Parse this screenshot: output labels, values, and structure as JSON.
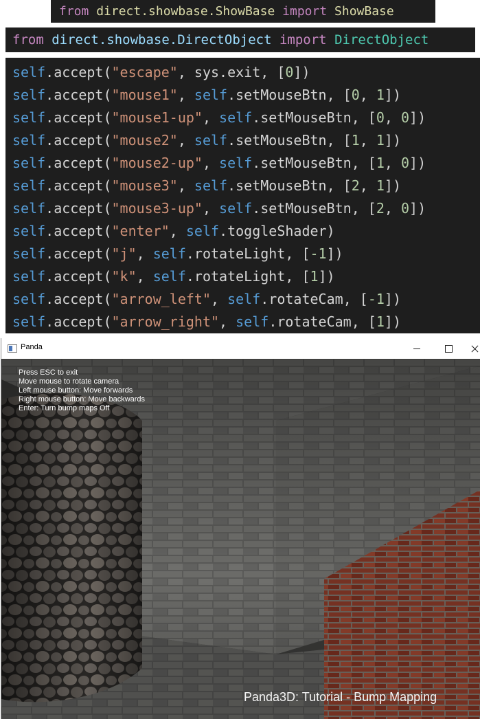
{
  "snippet1": {
    "keyword_from": "from",
    "module": "direct.showbase.ShowBase",
    "keyword_import": "import",
    "class": "ShowBase"
  },
  "snippet2": {
    "keyword_from": "from",
    "module": "direct.showbase.DirectObject",
    "keyword_import": "import",
    "class": "DirectObject"
  },
  "code_lines": [
    {
      "self": "self",
      "call": ".accept(",
      "event": "\"escape\"",
      "sep": ", ",
      "handler_self": "",
      "handler": "sys.exit",
      "args_pre": ", [",
      "a1": "0",
      "mid": "",
      "a2": "",
      "args_post": "])"
    },
    {
      "self": "self",
      "call": ".accept(",
      "event": "\"mouse1\"",
      "sep": ", ",
      "handler_self": "self",
      "handler": ".setMouseBtn",
      "args_pre": ", [",
      "a1": "0",
      "mid": ", ",
      "a2": "1",
      "args_post": "])"
    },
    {
      "self": "self",
      "call": ".accept(",
      "event": "\"mouse1-up\"",
      "sep": ", ",
      "handler_self": "self",
      "handler": ".setMouseBtn",
      "args_pre": ", [",
      "a1": "0",
      "mid": ", ",
      "a2": "0",
      "args_post": "])"
    },
    {
      "self": "self",
      "call": ".accept(",
      "event": "\"mouse2\"",
      "sep": ", ",
      "handler_self": "self",
      "handler": ".setMouseBtn",
      "args_pre": ", [",
      "a1": "1",
      "mid": ", ",
      "a2": "1",
      "args_post": "])"
    },
    {
      "self": "self",
      "call": ".accept(",
      "event": "\"mouse2-up\"",
      "sep": ", ",
      "handler_self": "self",
      "handler": ".setMouseBtn",
      "args_pre": ", [",
      "a1": "1",
      "mid": ", ",
      "a2": "0",
      "args_post": "])"
    },
    {
      "self": "self",
      "call": ".accept(",
      "event": "\"mouse3\"",
      "sep": ", ",
      "handler_self": "self",
      "handler": ".setMouseBtn",
      "args_pre": ", [",
      "a1": "2",
      "mid": ", ",
      "a2": "1",
      "args_post": "])"
    },
    {
      "self": "self",
      "call": ".accept(",
      "event": "\"mouse3-up\"",
      "sep": ", ",
      "handler_self": "self",
      "handler": ".setMouseBtn",
      "args_pre": ", [",
      "a1": "2",
      "mid": ", ",
      "a2": "0",
      "args_post": "])"
    },
    {
      "self": "self",
      "call": ".accept(",
      "event": "\"enter\"",
      "sep": ", ",
      "handler_self": "self",
      "handler": ".toggleShader",
      "args_pre": "",
      "a1": "",
      "mid": "",
      "a2": "",
      "args_post": ")"
    },
    {
      "self": "self",
      "call": ".accept(",
      "event": "\"j\"",
      "sep": ", ",
      "handler_self": "self",
      "handler": ".rotateLight",
      "args_pre": ", [",
      "a1": "-1",
      "mid": "",
      "a2": "",
      "args_post": "])"
    },
    {
      "self": "self",
      "call": ".accept(",
      "event": "\"k\"",
      "sep": ", ",
      "handler_self": "self",
      "handler": ".rotateLight",
      "args_pre": ", [",
      "a1": "1",
      "mid": "",
      "a2": "",
      "args_post": "])"
    },
    {
      "self": "self",
      "call": ".accept(",
      "event": "\"arrow_left\"",
      "sep": ", ",
      "handler_self": "self",
      "handler": ".rotateCam",
      "args_pre": ", [",
      "a1": "-1",
      "mid": "",
      "a2": "",
      "args_post": "])"
    },
    {
      "self": "self",
      "call": ".accept(",
      "event": "\"arrow_right\"",
      "sep": ", ",
      "handler_self": "self",
      "handler": ".rotateCam",
      "args_pre": ", [",
      "a1": "1",
      "mid": "",
      "a2": "",
      "args_post": "])"
    }
  ],
  "window": {
    "title": "Panda",
    "app_icon": "panda-app-icon",
    "controls": {
      "minimize": "minimize-icon",
      "maximize": "maximize-icon",
      "close": "close-icon"
    }
  },
  "instructions": [
    "Press ESC to exit",
    "Move mouse to rotate camera",
    "Left mouse button: Move forwards",
    "Right mouse button: Move backwards",
    "Enter: Turn bump maps Off"
  ],
  "scene_title": "Panda3D: Tutorial - Bump Mapping",
  "colors": {
    "editor_bg": "#1e1e1e",
    "keyword": "#c586c0",
    "function": "#dcdcaa",
    "module": "#9cdcfe",
    "class": "#4ec9b0",
    "self": "#569cd6",
    "string": "#ce9178",
    "number": "#b5cea8"
  }
}
